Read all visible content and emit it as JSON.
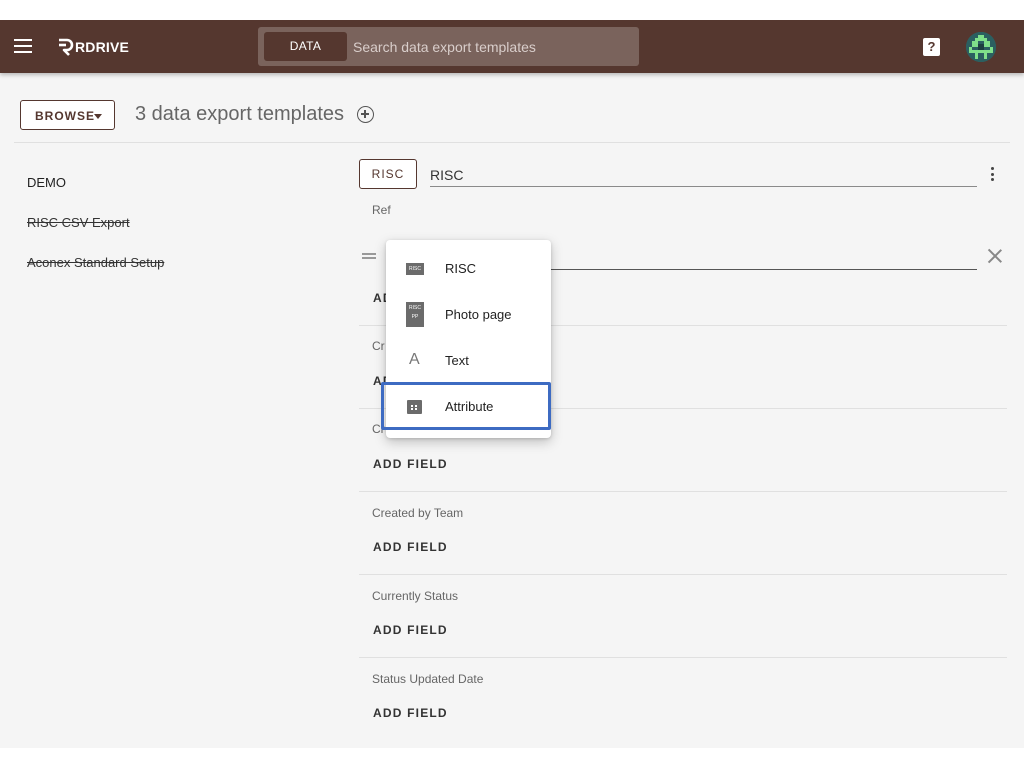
{
  "topbar": {
    "brand": "RDRIVE",
    "search_chip": "DATA",
    "search_placeholder": "Search data export templates",
    "help_glyph": "?",
    "colors": {
      "bar": "#55372f",
      "search": "#7a635c"
    }
  },
  "toolbar": {
    "browse_label": "BROWSE",
    "title": "3 data export templates"
  },
  "templates": [
    {
      "name": "DEMO",
      "struck": false
    },
    {
      "name": "RISC CSV Export",
      "struck": true
    },
    {
      "name": "Aconex Standard Setup",
      "struck": true
    }
  ],
  "editor": {
    "type_tag": "RISC",
    "template_name": "RISC",
    "sections": [
      {
        "label": "Ref",
        "action": "ADD FIELD"
      },
      {
        "label": "Cr",
        "action": "AD"
      },
      {
        "label": "Cr",
        "action": "ADD FIELD"
      },
      {
        "label": "Created by Team",
        "action": "ADD FIELD"
      },
      {
        "label": "Currently Status",
        "action": "ADD FIELD"
      },
      {
        "label": "Status Updated Date",
        "action": "ADD FIELD"
      }
    ]
  },
  "field_type_menu": {
    "items": [
      {
        "label": "RISC",
        "icon": "risc-doc-icon",
        "icon_text": "RISC"
      },
      {
        "label": "Photo page",
        "icon": "photo-page-icon",
        "icon_text": "RISC PP"
      },
      {
        "label": "Text",
        "icon": "text-icon",
        "icon_text": "A"
      },
      {
        "label": "Attribute",
        "icon": "attribute-icon"
      }
    ],
    "highlighted": "Attribute",
    "highlight_color": "#3d6bc2"
  }
}
